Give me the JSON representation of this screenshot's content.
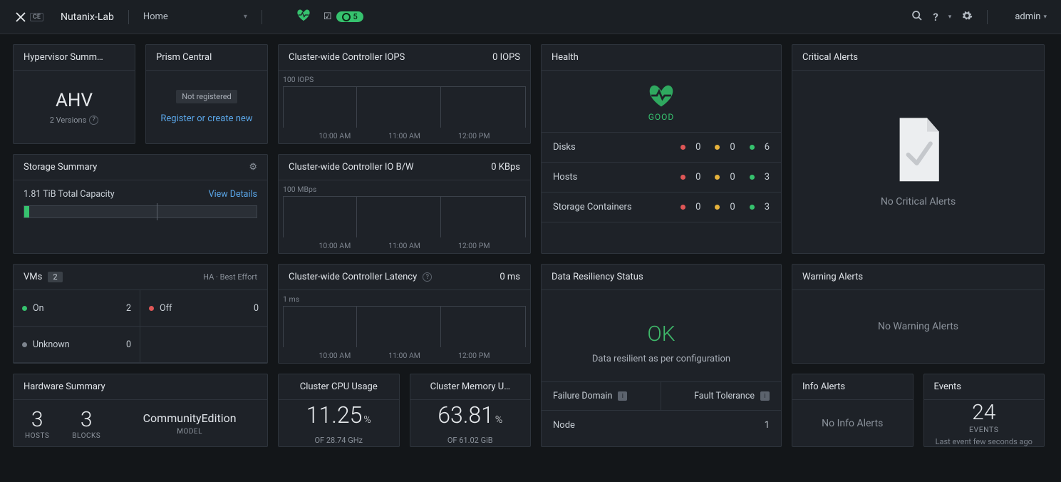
{
  "topbar": {
    "logo_small": "CE",
    "cluster_name": "Nutanix-Lab",
    "page": "Home",
    "task_count": "5",
    "admin_label": "admin"
  },
  "panels": {
    "hypervisor": {
      "title": "Hypervisor Summ…",
      "value": "AHV",
      "sub": "2 Versions"
    },
    "prism_central": {
      "title": "Prism Central",
      "status": "Not registered",
      "link": "Register or create new"
    },
    "iops": {
      "title": "Cluster-wide Controller IOPS",
      "value": "0 IOPS",
      "ylabel": "100 IOPS"
    },
    "bw": {
      "title": "Cluster-wide Controller IO B/W",
      "value": "0 KBps",
      "ylabel": "100 MBps"
    },
    "lat": {
      "title": "Cluster-wide Controller Latency",
      "value": "0 ms",
      "ylabel": "1 ms"
    },
    "chart_xlabels": [
      "10:00 AM",
      "11:00 AM",
      "12:00 PM"
    ],
    "storage": {
      "title": "Storage Summary",
      "capacity": "1.81 TiB  Total Capacity",
      "view": "View Details"
    },
    "vms": {
      "title": "VMs",
      "count": "2",
      "ha": "HA  ·  Best Effort",
      "on_label": "On",
      "on_val": "2",
      "off_label": "Off",
      "off_val": "0",
      "unk_label": "Unknown",
      "unk_val": "0"
    },
    "hardware": {
      "title": "Hardware Summary",
      "hosts_n": "3",
      "hosts_l": "HOSTS",
      "blocks_n": "3",
      "blocks_l": "BLOCKS",
      "model": "CommunityEdition",
      "model_l": "MODEL"
    },
    "cpu": {
      "title": "Cluster CPU Usage",
      "value": "11.25",
      "pct": "%",
      "of": "OF 28.74 GHz"
    },
    "mem": {
      "title": "Cluster Memory U…",
      "value": "63.81",
      "pct": "%",
      "of": "OF 61.02 GiB"
    },
    "health": {
      "title": "Health",
      "status": "GOOD",
      "rows": [
        {
          "label": "Disks",
          "r": "0",
          "y": "0",
          "g": "6"
        },
        {
          "label": "Hosts",
          "r": "0",
          "y": "0",
          "g": "3"
        },
        {
          "label": "Storage Containers",
          "r": "0",
          "y": "0",
          "g": "3"
        }
      ]
    },
    "dr": {
      "title": "Data Resiliency Status",
      "ok": "OK",
      "sub": "Data resilient as per configuration",
      "fd": "Failure Domain",
      "ft": "Fault Tolerance",
      "node_label": "Node",
      "node_val": "1"
    },
    "critical": {
      "title": "Critical Alerts",
      "msg": "No Critical Alerts"
    },
    "warning": {
      "title": "Warning Alerts",
      "msg": "No Warning Alerts"
    },
    "info": {
      "title": "Info Alerts",
      "msg": "No Info Alerts"
    },
    "events": {
      "title": "Events",
      "count": "24",
      "label": "EVENTS",
      "sub": "Last event few seconds ago"
    }
  },
  "chart_data": [
    {
      "type": "line",
      "title": "Cluster-wide Controller IOPS",
      "ylabel": "IOPS",
      "ylim": [
        0,
        100
      ],
      "x": [
        "10:00 AM",
        "11:00 AM",
        "12:00 PM"
      ],
      "values": [
        0,
        0,
        0
      ]
    },
    {
      "type": "line",
      "title": "Cluster-wide Controller IO B/W",
      "ylabel": "MBps",
      "ylim": [
        0,
        100
      ],
      "x": [
        "10:00 AM",
        "11:00 AM",
        "12:00 PM"
      ],
      "values": [
        0,
        0,
        0
      ]
    },
    {
      "type": "line",
      "title": "Cluster-wide Controller Latency",
      "ylabel": "ms",
      "ylim": [
        0,
        1
      ],
      "x": [
        "10:00 AM",
        "11:00 AM",
        "12:00 PM"
      ],
      "values": [
        0,
        0,
        0
      ]
    }
  ]
}
